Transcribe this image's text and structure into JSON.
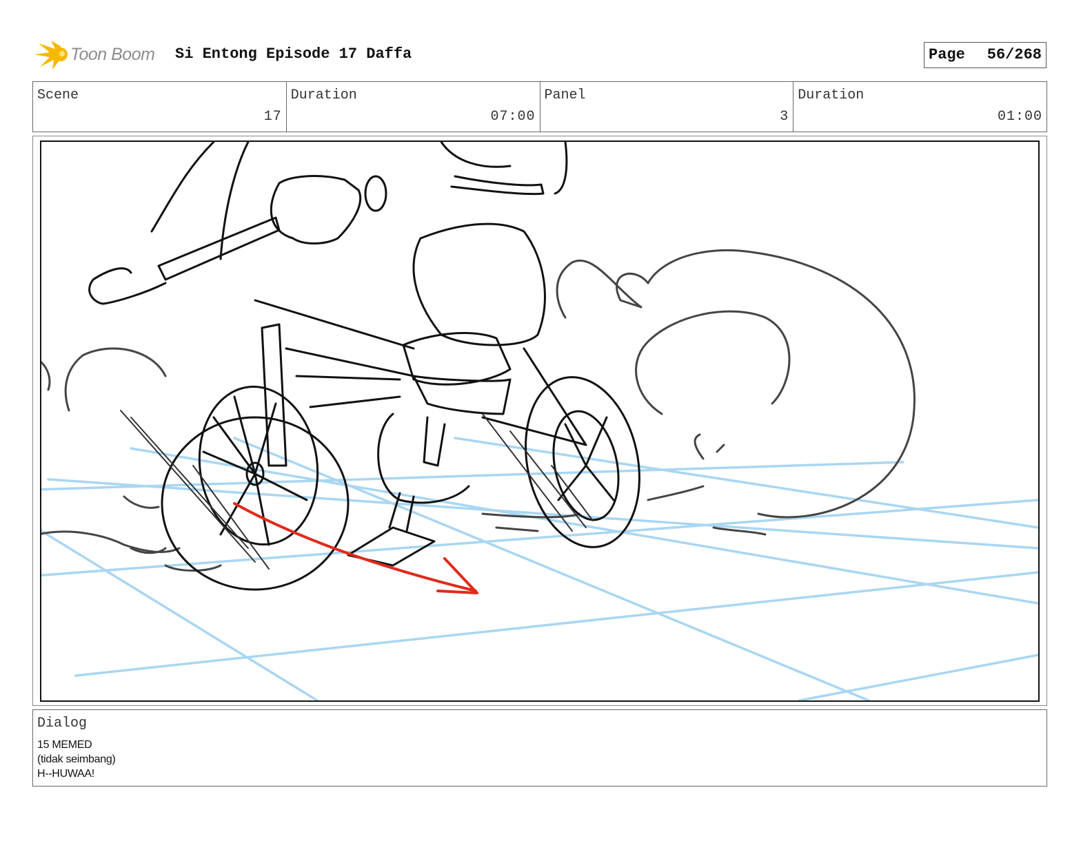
{
  "header": {
    "logo_text": "Toon Boom",
    "project_title": "Si Entong Episode 17 Daffa",
    "page_label": "Page",
    "page_value": "56/268"
  },
  "info": {
    "scene_label": "Scene",
    "scene_value": "17",
    "scene_duration_label": "Duration",
    "scene_duration_value": "07:00",
    "panel_label": "Panel",
    "panel_value": "3",
    "panel_duration_label": "Duration",
    "panel_duration_value": "01:00"
  },
  "dialog": {
    "label": "Dialog",
    "lines": [
      "15 MEMED",
      "(tidak seimbang)",
      "H--HUWAA!"
    ]
  },
  "colors": {
    "logo_star": "#f5b800",
    "sketch_line": "#111111",
    "smoke_line": "#444444",
    "perspective_grid": "#a9d6f2",
    "motion_arrow": "#e02a1b"
  },
  "icons": {
    "logo": "toon-boom-star-icon"
  }
}
